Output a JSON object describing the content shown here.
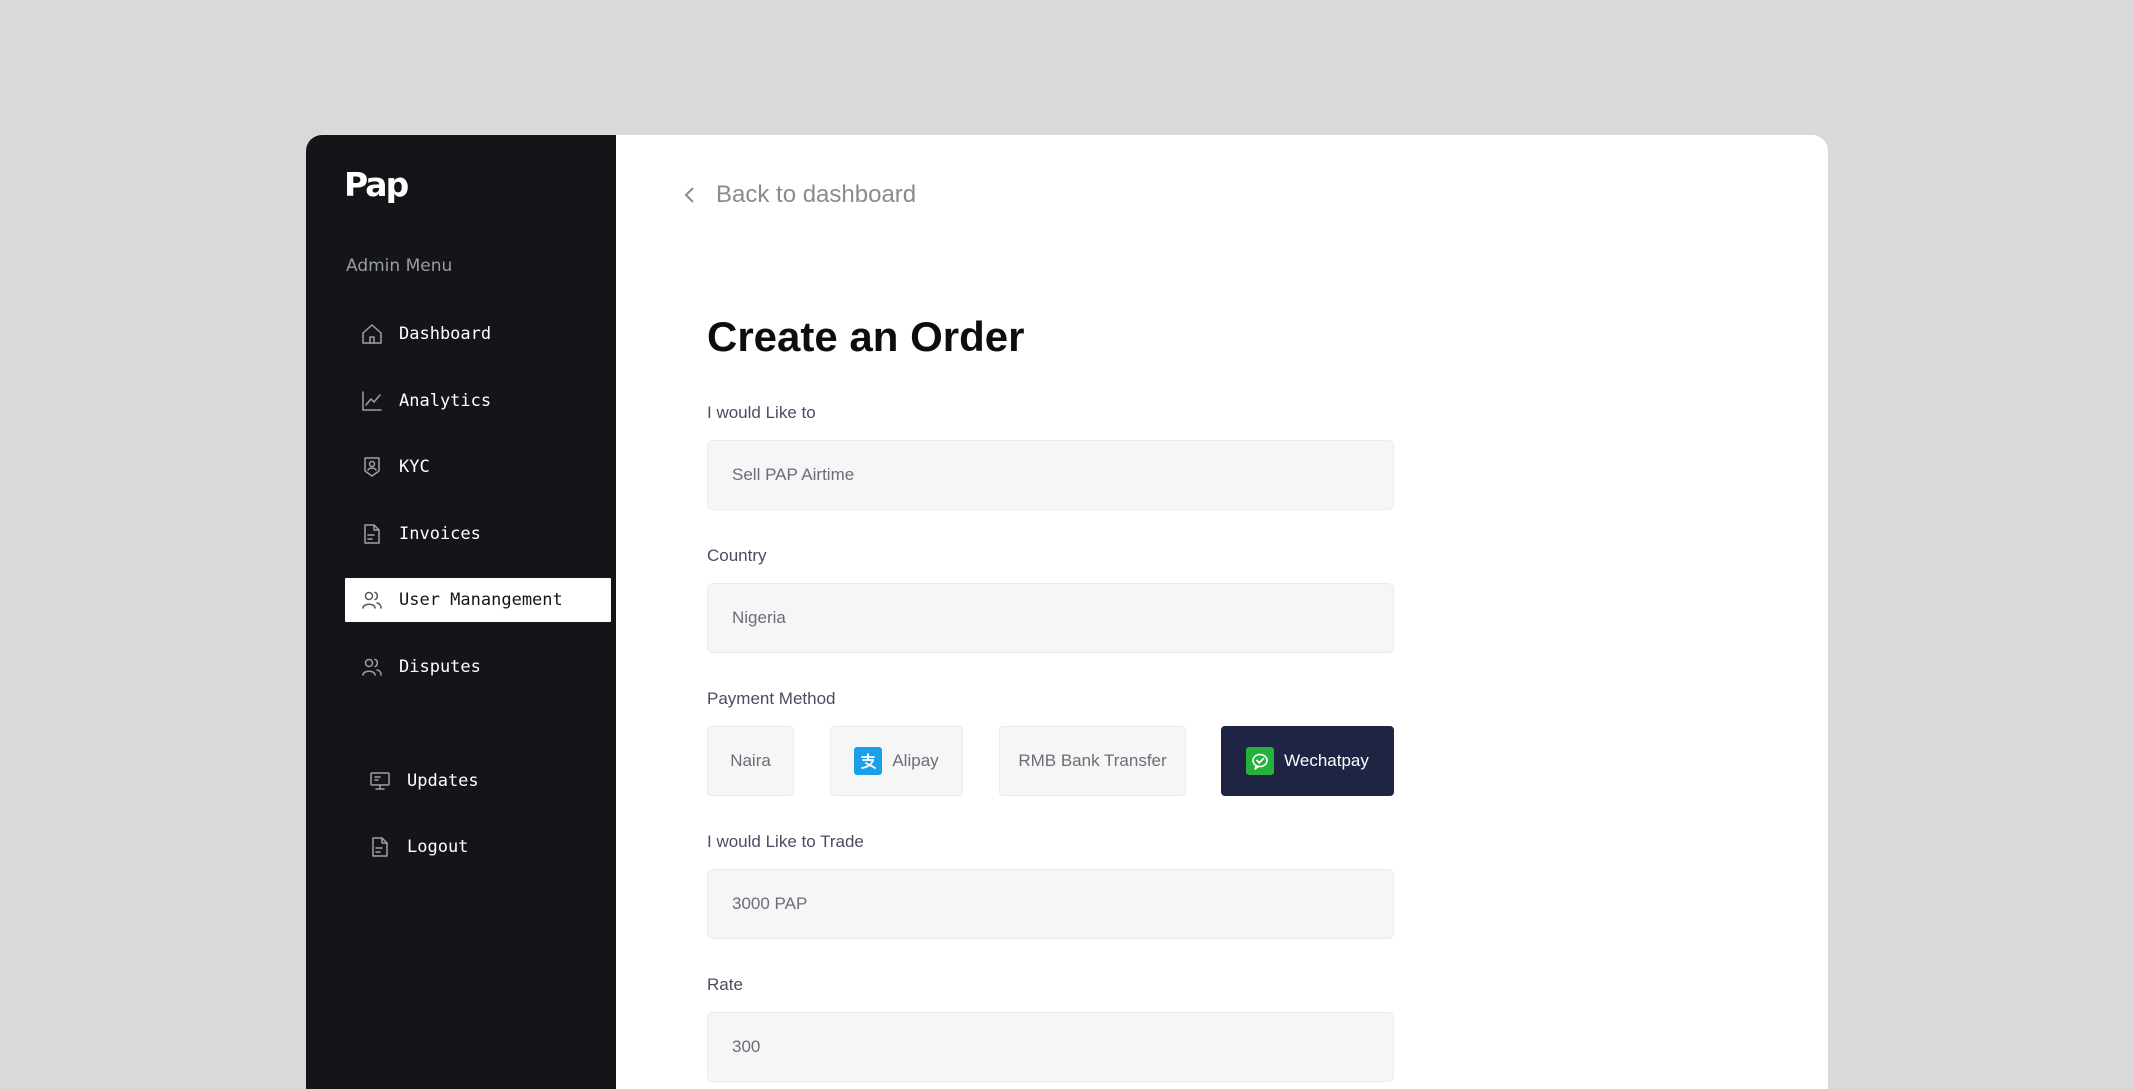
{
  "sidebar": {
    "logo": "Pap",
    "menu_heading": "Admin Menu",
    "items": [
      {
        "label": "Dashboard",
        "icon": "home-icon"
      },
      {
        "label": "Analytics",
        "icon": "chart-line-icon"
      },
      {
        "label": "KYC",
        "icon": "user-shield-icon"
      },
      {
        "label": "Invoices",
        "icon": "document-icon"
      },
      {
        "label": "User Manangement",
        "icon": "users-icon",
        "active": true
      },
      {
        "label": "Disputes",
        "icon": "users-icon"
      }
    ],
    "bottom_items": [
      {
        "label": "Updates",
        "icon": "monitor-icon"
      },
      {
        "label": "Logout",
        "icon": "document-icon"
      }
    ]
  },
  "main": {
    "back_label": "Back to dashboard",
    "title": "Create an Order",
    "fields": {
      "action": {
        "label": "I would Like to",
        "value": "Sell PAP Airtime"
      },
      "country": {
        "label": "Country",
        "value": "Nigeria"
      },
      "payment": {
        "label": "Payment Method",
        "options": [
          {
            "label": "Naira",
            "icon": null
          },
          {
            "label": "Alipay",
            "icon": "alipay-icon"
          },
          {
            "label": "RMB Bank Transfer",
            "icon": null
          },
          {
            "label": "Wechatpay",
            "icon": "wechat-icon",
            "selected": true
          }
        ]
      },
      "trade": {
        "label": "I would Like to Trade",
        "value": "3000 PAP"
      },
      "rate": {
        "label": "Rate",
        "value": "300"
      }
    }
  },
  "colors": {
    "sidebar_bg": "#141518",
    "page_bg": "#d9d9d9",
    "selected_payment_bg": "#1f2344",
    "alipay_blue": "#1a9fe8",
    "wechat_green": "#24b23a"
  }
}
